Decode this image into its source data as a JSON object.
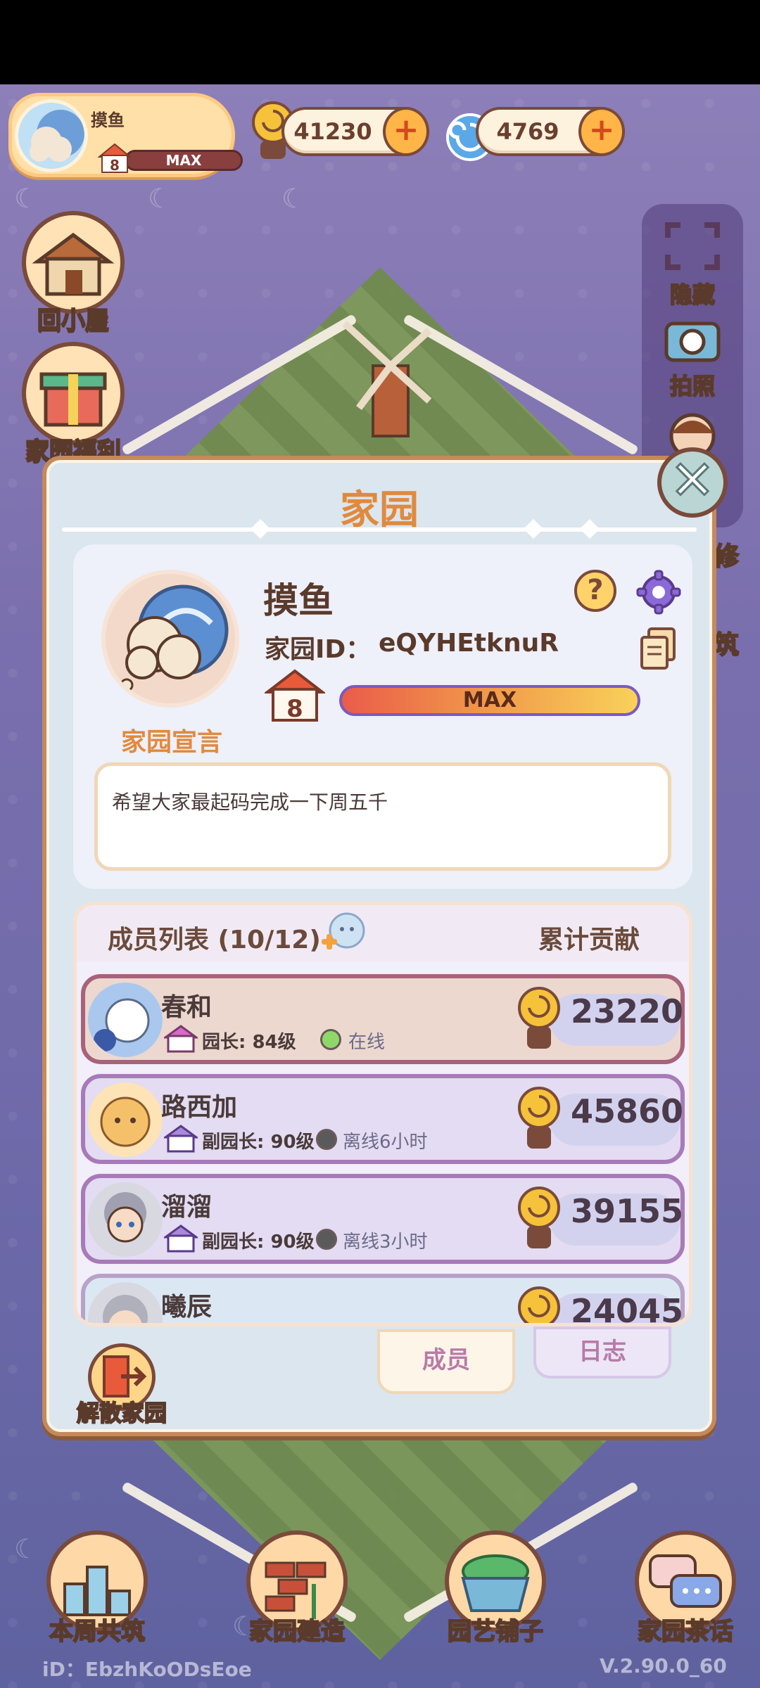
{
  "hud": {
    "player_name": "摸鱼",
    "house_level": "8",
    "level_status": "MAX",
    "coins": "41230",
    "gems": "4769",
    "add_symbol": "+"
  },
  "side_buttons": {
    "home": "回小屋",
    "welfare": "家园福利"
  },
  "right_panel": {
    "hide": "隐藏",
    "photo": "拍照",
    "decorate": "修",
    "build": "筑"
  },
  "modal": {
    "title": "家园",
    "close_symbol": "✕",
    "home_name": "摸鱼",
    "home_id_label": "家园ID：",
    "home_id": "eQYHEtknuR",
    "help_symbol": "?",
    "house_level": "8",
    "level_status": "MAX",
    "manifesto_label": "家园宣言",
    "manifesto_text": "希望大家最起码完成一下周五千",
    "members_title": "成员列表 (10/12)",
    "contribution_title": "累计贡献",
    "members": [
      {
        "name": "春和",
        "role": "园长: 84级",
        "status": "在线",
        "score": "23220",
        "online": true
      },
      {
        "name": "路西加",
        "role": "副园长: 90级",
        "status": "离线6小时",
        "score": "45860",
        "online": false
      },
      {
        "name": "溜溜",
        "role": "副园长: 90级",
        "status": "离线3小时",
        "score": "39155",
        "online": false
      },
      {
        "name": "曦辰",
        "role": "",
        "status": "",
        "score": "24045",
        "online": false
      }
    ],
    "tab_members": "成员",
    "tab_log": "日志",
    "dissolve": "解散家园"
  },
  "bottom_nav": {
    "weekly": "本周共筑",
    "build": "家园建造",
    "shop": "园艺铺子",
    "chat": "家园茶话"
  },
  "footer": {
    "id": "iD：EbzhKoODsEoe",
    "version": "V.2.90.0_60"
  },
  "colors": {
    "title_orange": "#e08a3e",
    "frame_brown": "#7a4a3a",
    "online_green": "#8ed86a",
    "offline_grey": "#5a5a5a"
  }
}
